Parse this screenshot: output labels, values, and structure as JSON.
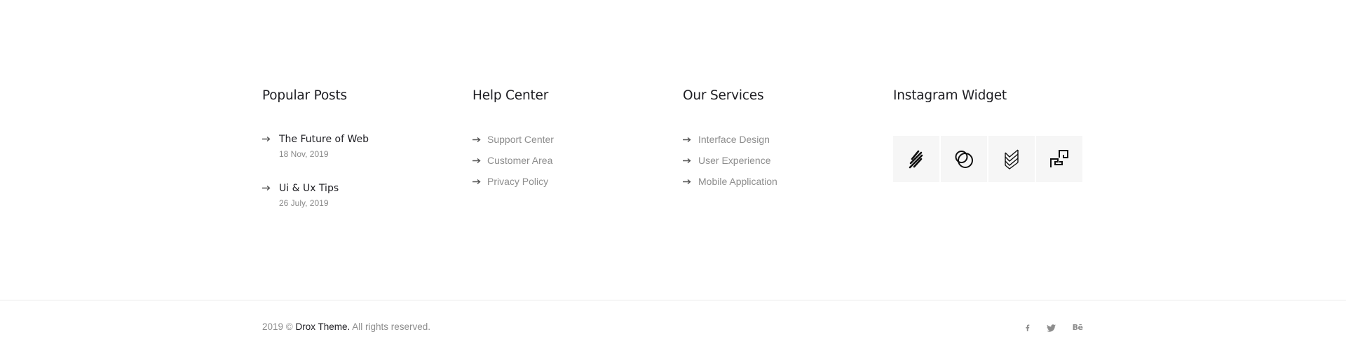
{
  "popular_posts": {
    "title": "Popular Posts",
    "posts": [
      {
        "title": "The Future of Web",
        "date": "18 Nov, 2019"
      },
      {
        "title": "Ui & Ux Tips",
        "date": "26 July, 2019"
      }
    ]
  },
  "help_center": {
    "title": "Help Center",
    "links": [
      "Support Center",
      "Customer Area",
      "Privacy Policy"
    ]
  },
  "our_services": {
    "title": "Our Services",
    "links": [
      "Interface Design",
      "User Experience",
      "Mobile Application"
    ]
  },
  "instagram": {
    "title": "Instagram Widget",
    "tiles": [
      "slashes-logo-icon",
      "overlapping-circles-logo-icon",
      "stacked-chevrons-logo-icon",
      "square-steps-logo-icon"
    ]
  },
  "footer": {
    "copyright_prefix": "2019 © ",
    "brand": "Drox Theme.",
    "copyright_suffix": " All rights reserved.",
    "socials": [
      {
        "icon": "facebook-icon",
        "glyph": "f"
      },
      {
        "icon": "twitter-icon",
        "glyph": ""
      },
      {
        "icon": "behance-icon",
        "glyph": "Bē"
      }
    ]
  },
  "colors": {
    "heading": "#1d1d22",
    "muted": "#8d8d8d",
    "tile_bg": "#f6f6f6",
    "divider": "#ececec"
  }
}
